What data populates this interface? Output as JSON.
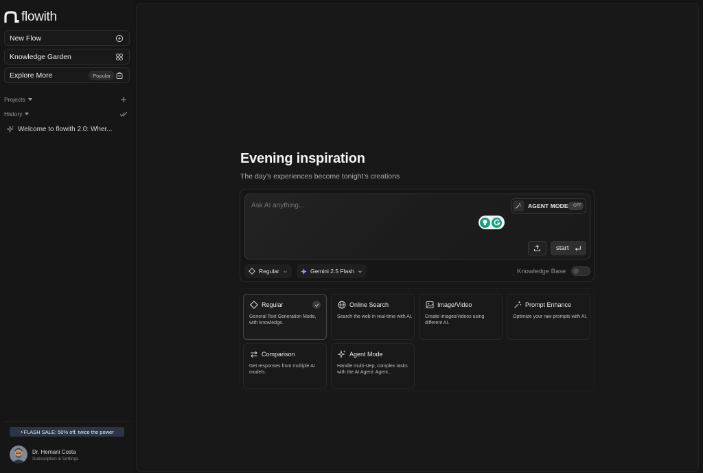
{
  "app": {
    "name": "flowith"
  },
  "sidebar": {
    "items": [
      {
        "label": "New Flow",
        "icon": "chat-plus-icon"
      },
      {
        "label": "Knowledge Garden",
        "icon": "grid-flower-icon"
      },
      {
        "label": "Explore More",
        "badge": "Popular",
        "icon": "bag-icon"
      }
    ],
    "projects_label": "Projects",
    "history_label": "History",
    "history": [
      {
        "title": "Welcome to flowith 2.0: Wher..."
      }
    ],
    "flash_sale": "⚡FLASH SALE: 50% off, twice the power",
    "user": {
      "name": "Dr. Hernani Costa",
      "subtitle": "Subscription & Settings"
    }
  },
  "main": {
    "title": "Evening inspiration",
    "subtitle": "The day's experiences become tonight's creations",
    "composer": {
      "placeholder": "Ask AI anything...",
      "agent_mode_label": "AGENT MODE",
      "agent_mode_state": "OFF",
      "start_label": "start"
    },
    "chips": {
      "mode": "Regular",
      "model": "Gemini 2.5 Flash"
    },
    "knowledge_base_label": "Knowledge Base",
    "modes": [
      {
        "title": "Regular",
        "desc": "General Text Generation Mode, with knowledge.",
        "icon": "diamond-icon",
        "selected": true
      },
      {
        "title": "Online Search",
        "desc": "Search the web in real-time with AI.",
        "icon": "globe-icon",
        "selected": false
      },
      {
        "title": "Image/Video",
        "desc": "Create images/videos using different AI.",
        "icon": "image-icon",
        "selected": false
      },
      {
        "title": "Prompt Enhance",
        "desc": "Optimize your raw prompts with AI.",
        "icon": "wand-icon",
        "selected": false
      },
      {
        "title": "Comparison",
        "desc": "Get responses from multiple AI models.",
        "icon": "swap-icon",
        "selected": false
      },
      {
        "title": "Agent Mode",
        "desc": "Handle multi-step, complex tasks with the AI Agent: Agent...",
        "icon": "sparkle-icon",
        "selected": false
      }
    ]
  },
  "colors": {
    "background": "#141414",
    "panel": "#181818",
    "accent_grammarly": "#15a37f",
    "flash_banner": "#2d3446"
  }
}
